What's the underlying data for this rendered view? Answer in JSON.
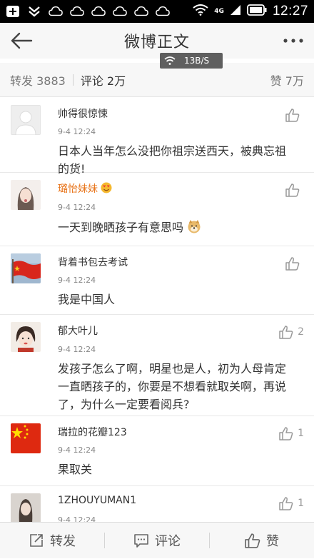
{
  "status_bar": {
    "time": "12:27",
    "network": "4G"
  },
  "nav": {
    "title": "微博正文"
  },
  "speed_indicator": {
    "text": "13B/S"
  },
  "tabs": {
    "repost": "转发 3883",
    "comment": "评论 2万",
    "like": "赞 7万"
  },
  "comments": [
    {
      "name": "帅得很惊悚",
      "time": "9-4 12:24",
      "text": "日本人当年怎么没把你祖宗送西天，被典忘祖的货!",
      "likes": ""
    },
    {
      "name": "璐怡妹妹",
      "time": "9-4 12:24",
      "text": "一天到晚晒孩子有意思吗",
      "likes": ""
    },
    {
      "name": "背着书包去考试",
      "time": "9-4 12:24",
      "text": "我是中国人",
      "likes": ""
    },
    {
      "name": "郁大叶儿",
      "time": "9-4 12:24",
      "text": "发孩子怎么了啊，明星也是人，初为人母肯定一直晒孩子的，你要是不想看就取关啊，再说了，为什么一定要看阅兵?",
      "likes": "2"
    },
    {
      "name": "瑞拉的花瓣123",
      "time": "9-4 12:24",
      "text": "果取关",
      "likes": "1"
    },
    {
      "name": "1ZHOUYUMAN1",
      "time": "9-4 12:24",
      "text": "",
      "likes": "1"
    }
  ],
  "bottom_bar": {
    "repost": "转发",
    "comment": "评论",
    "like": "赞"
  },
  "colors": {
    "orange_name": "#e8741a",
    "bar_bg": "#f7f7f7"
  }
}
